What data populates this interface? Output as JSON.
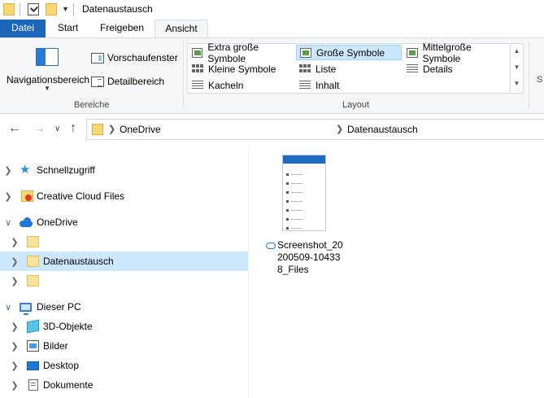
{
  "window": {
    "title": "Datenaustausch"
  },
  "ribbon_tabs": {
    "datei": "Datei",
    "start": "Start",
    "freigeben": "Freigeben",
    "ansicht": "Ansicht"
  },
  "ribbon": {
    "bereiche": {
      "label": "Bereiche",
      "navigationsbereich": "Navigationsbereich",
      "vorschaufenster": "Vorschaufenster",
      "detailbereich": "Detailbereich"
    },
    "layout": {
      "label": "Layout",
      "items": [
        {
          "label": "Extra große Symbole",
          "icon": "picture-icon"
        },
        {
          "label": "Große Symbole",
          "icon": "picture-icon",
          "selected": true
        },
        {
          "label": "Mittelgroße Symbole",
          "icon": "picture-icon"
        },
        {
          "label": "Kleine Symbole",
          "icon": "grid-icon"
        },
        {
          "label": "Liste",
          "icon": "list-icon"
        },
        {
          "label": "Details",
          "icon": "details-icon"
        },
        {
          "label": "Kacheln",
          "icon": "tiles-icon"
        },
        {
          "label": "Inhalt",
          "icon": "content-icon"
        }
      ]
    },
    "next_group_partial": "S"
  },
  "address": {
    "crumbs": [
      "OneDrive",
      "Datenaustausch"
    ]
  },
  "nav": {
    "items": [
      {
        "label": "Schnellzugriff",
        "icon": "star-icon"
      },
      {
        "label": "Creative Cloud Files",
        "icon": "creative-cloud-folder-icon"
      },
      {
        "label": "OneDrive",
        "icon": "onedrive-cloud-icon",
        "expanded": true
      },
      {
        "label": "",
        "icon": "folder-icon"
      },
      {
        "label": "Datenaustausch",
        "icon": "folder-icon",
        "selected": true
      },
      {
        "label": "",
        "icon": "folder-icon"
      },
      {
        "label": "Dieser PC",
        "icon": "pc-icon",
        "expanded": true
      },
      {
        "label": "3D-Objekte",
        "icon": "3d-objects-icon"
      },
      {
        "label": "Bilder",
        "icon": "pictures-icon"
      },
      {
        "label": "Desktop",
        "icon": "desktop-icon"
      },
      {
        "label": "Dokumente",
        "icon": "documents-icon"
      }
    ]
  },
  "content": {
    "files": [
      {
        "name": "Screenshot_20200509-104338_Files",
        "status_icon": "cloud-sync-icon"
      }
    ]
  },
  "colors": {
    "accent": "#1b66b9",
    "selection": "#cce8ff",
    "folder": "#f8d775"
  }
}
